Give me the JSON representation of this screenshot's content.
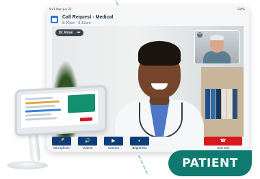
{
  "status_bar": {
    "left_text": "9:41  Mon Jun 22",
    "right_text": "100%"
  },
  "header": {
    "title": "Call Request - Medical",
    "time_range": "8:00am - 8:15am",
    "icon": "calendar-icon"
  },
  "video": {
    "participant_name": "Dr. Rose",
    "menu_glyph": "•••",
    "pip_menu_glyph": "•••"
  },
  "controls": [
    {
      "label": "Microphone",
      "icon": "microphone-icon",
      "glyph": "🎤"
    },
    {
      "label": "Volume",
      "icon": "volume-icon",
      "glyph": "🔊"
    },
    {
      "label": "Camera",
      "icon": "camera-icon",
      "glyph": "▶"
    },
    {
      "label": "Brightness",
      "icon": "brightness-icon",
      "glyph": "◐"
    }
  ],
  "end_call": {
    "label": "End Call",
    "icon": "phone-hangup-icon",
    "glyph": "☎"
  },
  "badge": {
    "text": "PATIENT"
  },
  "colors": {
    "primary_button": "#0e3e78",
    "end_call": "#d6181f",
    "badge": "#0f7a6f"
  }
}
